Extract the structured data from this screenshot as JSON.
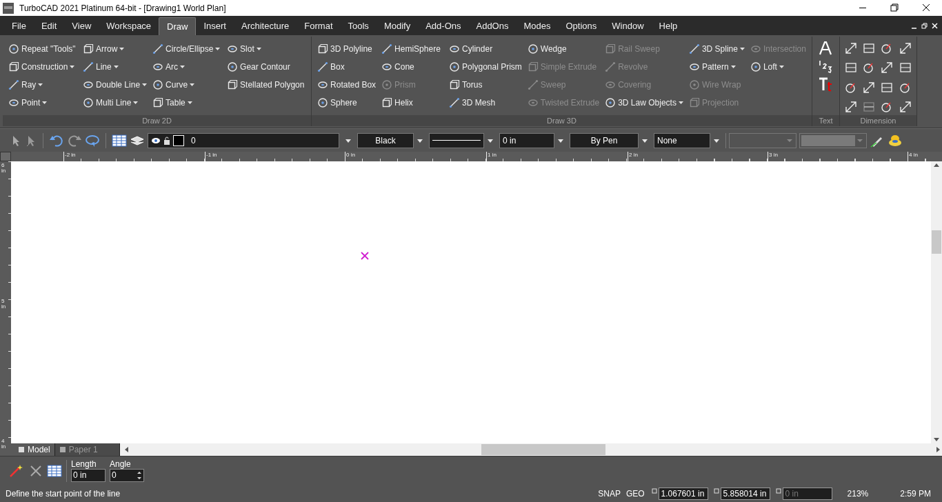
{
  "window": {
    "title": "TurboCAD 2021 Platinum 64-bit - [Drawing1 World Plan]"
  },
  "menu": [
    {
      "label": "File",
      "selected": false
    },
    {
      "label": "Edit",
      "selected": false
    },
    {
      "label": "View",
      "selected": false
    },
    {
      "label": "Workspace",
      "selected": false
    },
    {
      "label": "Draw",
      "selected": true
    },
    {
      "label": "Insert",
      "selected": false
    },
    {
      "label": "Architecture",
      "selected": false
    },
    {
      "label": "Format",
      "selected": false
    },
    {
      "label": "Tools",
      "selected": false
    },
    {
      "label": "Modify",
      "selected": false
    },
    {
      "label": "Add-Ons",
      "selected": false
    },
    {
      "label": "AddOns",
      "selected": false
    },
    {
      "label": "Modes",
      "selected": false
    },
    {
      "label": "Options",
      "selected": false
    },
    {
      "label": "Window",
      "selected": false
    },
    {
      "label": "Help",
      "selected": false
    }
  ],
  "ribbon": [
    {
      "kind": "tools",
      "label": "Draw 2D",
      "columns": [
        [
          {
            "label": "Repeat \"Tools\"",
            "dropdown": false,
            "disabled": false
          },
          {
            "label": "Construction",
            "dropdown": true,
            "disabled": false
          },
          {
            "label": "Ray",
            "dropdown": true,
            "disabled": false
          },
          {
            "label": "Point",
            "dropdown": true,
            "disabled": false
          }
        ],
        [
          {
            "label": "Arrow",
            "dropdown": true,
            "disabled": false
          },
          {
            "label": "Line",
            "dropdown": true,
            "disabled": false
          },
          {
            "label": "Double Line",
            "dropdown": true,
            "disabled": false
          },
          {
            "label": "Multi Line",
            "dropdown": true,
            "disabled": false
          }
        ],
        [
          {
            "label": "Circle/Ellipse",
            "dropdown": true,
            "disabled": false
          },
          {
            "label": "Arc",
            "dropdown": true,
            "disabled": false
          },
          {
            "label": "Curve",
            "dropdown": true,
            "disabled": false
          },
          {
            "label": "Table",
            "dropdown": true,
            "disabled": false
          }
        ],
        [
          {
            "label": "Slot",
            "dropdown": true,
            "disabled": false
          },
          {
            "label": "Gear Contour",
            "dropdown": false,
            "disabled": false
          },
          {
            "label": "Stellated Polygon",
            "dropdown": false,
            "disabled": false
          }
        ]
      ]
    },
    {
      "kind": "tools",
      "label": "Draw 3D",
      "columns": [
        [
          {
            "label": "3D Polyline",
            "dropdown": false,
            "disabled": false
          },
          {
            "label": "Box",
            "dropdown": false,
            "disabled": false
          },
          {
            "label": "Rotated Box",
            "dropdown": false,
            "disabled": false
          },
          {
            "label": "Sphere",
            "dropdown": false,
            "disabled": false
          }
        ],
        [
          {
            "label": "HemiSphere",
            "dropdown": false,
            "disabled": false
          },
          {
            "label": "Cone",
            "dropdown": false,
            "disabled": false
          },
          {
            "label": "Prism",
            "dropdown": false,
            "disabled": true
          },
          {
            "label": "Helix",
            "dropdown": false,
            "disabled": false
          }
        ],
        [
          {
            "label": "Cylinder",
            "dropdown": false,
            "disabled": false
          },
          {
            "label": "Polygonal Prism",
            "dropdown": false,
            "disabled": false
          },
          {
            "label": "Torus",
            "dropdown": false,
            "disabled": false
          },
          {
            "label": "3D Mesh",
            "dropdown": false,
            "disabled": false
          }
        ],
        [
          {
            "label": "Wedge",
            "dropdown": false,
            "disabled": false
          },
          {
            "label": "Simple Extrude",
            "dropdown": false,
            "disabled": true
          },
          {
            "label": "Sweep",
            "dropdown": false,
            "disabled": true
          },
          {
            "label": "Twisted Extrude",
            "dropdown": false,
            "disabled": true
          }
        ],
        [
          {
            "label": "Rail Sweep",
            "dropdown": false,
            "disabled": true
          },
          {
            "label": "Revolve",
            "dropdown": false,
            "disabled": true
          },
          {
            "label": "Covering",
            "dropdown": false,
            "disabled": true
          },
          {
            "label": "3D Law Objects",
            "dropdown": true,
            "disabled": false
          }
        ],
        [
          {
            "label": "3D Spline",
            "dropdown": true,
            "disabled": false
          },
          {
            "label": "Pattern",
            "dropdown": true,
            "disabled": false
          },
          {
            "label": "Wire Wrap",
            "dropdown": false,
            "disabled": true
          },
          {
            "label": "Projection",
            "dropdown": false,
            "disabled": true
          }
        ],
        [
          {
            "label": "Intersection",
            "dropdown": false,
            "disabled": true
          },
          {
            "label": "Loft",
            "dropdown": true,
            "disabled": false
          }
        ]
      ]
    },
    {
      "kind": "text",
      "label": "Text"
    },
    {
      "kind": "dimension",
      "label": "Dimension"
    }
  ],
  "toolbar": {
    "layer": "0",
    "color_label": "Black",
    "line_width": "0 in",
    "pen": "By Pen",
    "pattern": "None"
  },
  "ruler": {
    "horizontal": [
      "-2 in",
      "-1 in",
      "0 in",
      "1 in",
      "2 in",
      "3 in",
      "4 in"
    ],
    "vertical": [
      "6 in",
      "5 in",
      "4 in"
    ]
  },
  "sheet_tabs": [
    {
      "label": "Model",
      "selected": true
    },
    {
      "label": "Paper 1",
      "selected": false
    }
  ],
  "inspector": {
    "length_label": "Length",
    "length": "0 in",
    "angle_label": "Angle",
    "angle": "0"
  },
  "status_bar": {
    "message": "Define the start point of the line",
    "snap": "SNAP",
    "geo": "GEO",
    "x": "1.067601 in",
    "y": "5.858014 in",
    "z": "0 in",
    "zoom": "213%",
    "time": "2:59 PM"
  }
}
